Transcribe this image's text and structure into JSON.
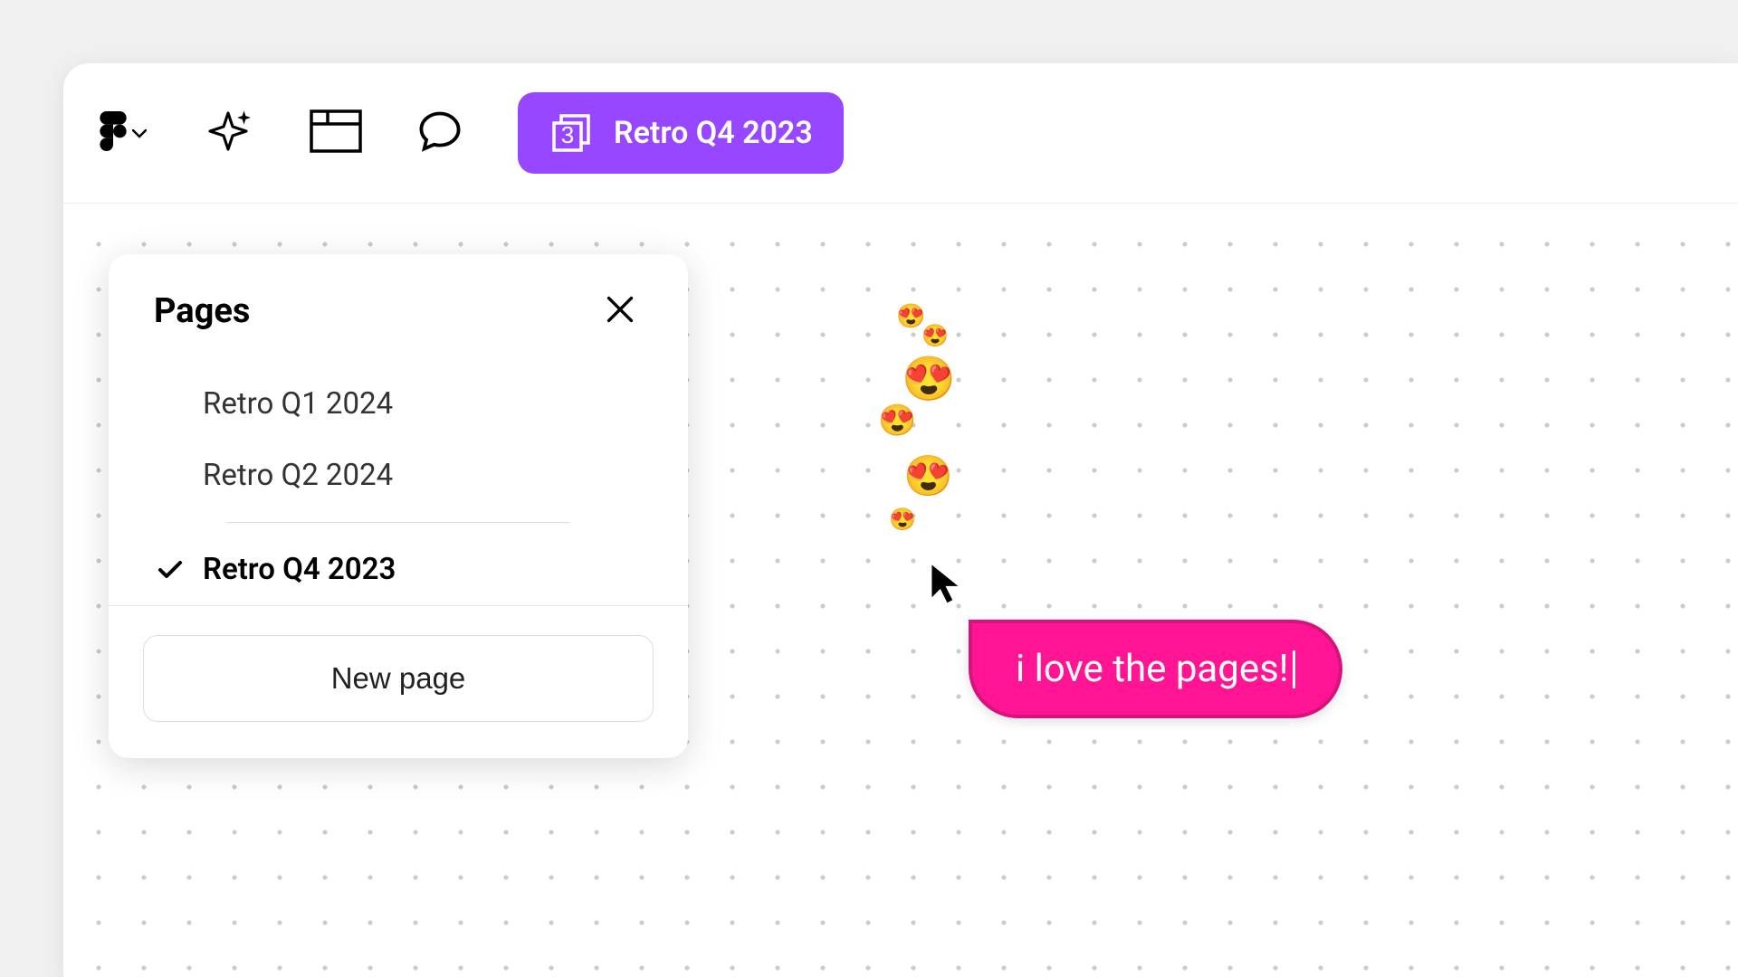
{
  "toolbar": {
    "page_chip": {
      "count": "3",
      "label": "Retro Q4 2023"
    }
  },
  "pages_panel": {
    "title": "Pages",
    "items": [
      {
        "label": "Retro Q1 2024",
        "selected": false
      },
      {
        "label": "Retro Q2 2024",
        "selected": false
      },
      {
        "label": "Retro Q4 2023",
        "selected": true
      }
    ],
    "new_page_label": "New page"
  },
  "chat_bubble": {
    "text": "i love the pages!"
  },
  "colors": {
    "accent_purple": "#9747FF",
    "bubble_pink": "#FF1493",
    "bubble_border": "#D6127C"
  },
  "reactions": {
    "emoji": "heart-eyes",
    "count": 6
  }
}
